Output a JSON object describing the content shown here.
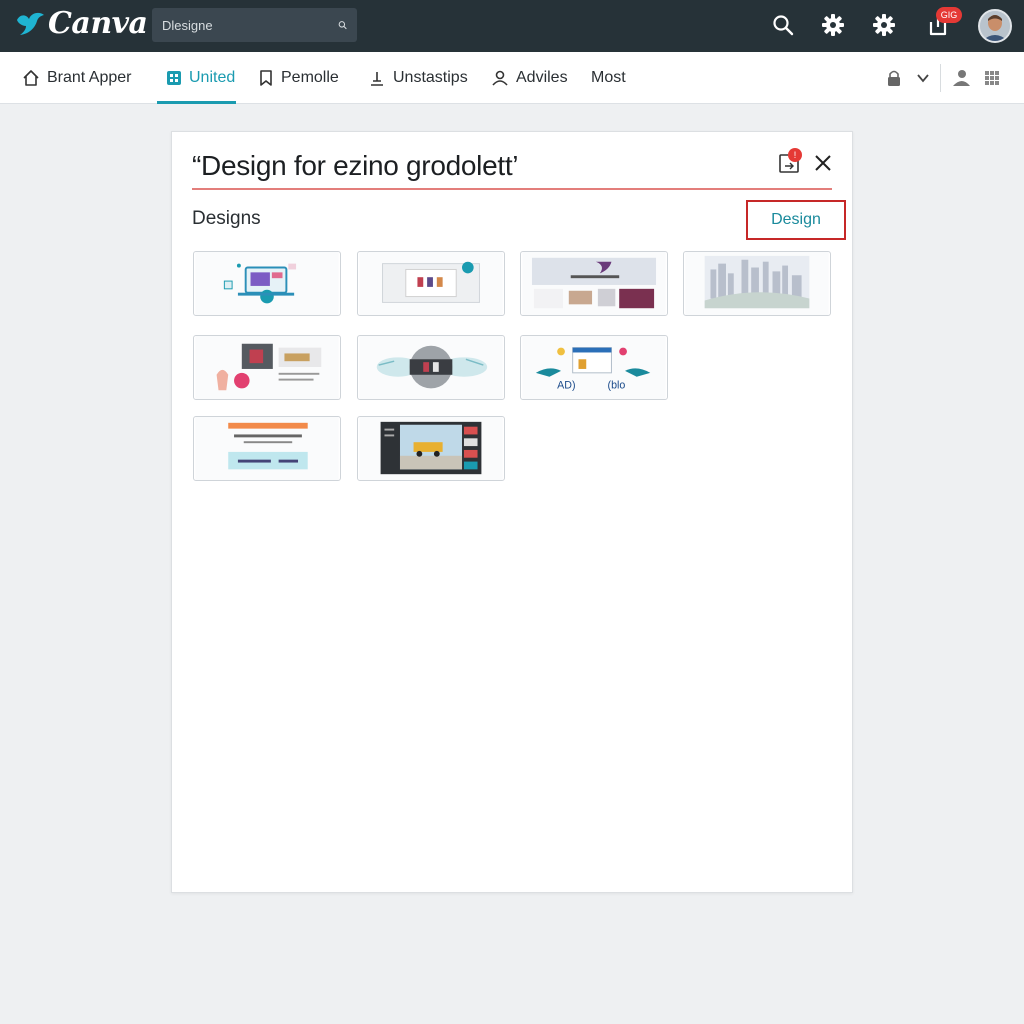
{
  "app": {
    "logo_text": "Canva",
    "brand_color": "#1fb4d2"
  },
  "search": {
    "placeholder": "Dlesigne"
  },
  "header": {
    "notification_badge": "GIG"
  },
  "nav": {
    "items": [
      {
        "label": "Brant Apper",
        "icon": "home-icon"
      },
      {
        "label": "United",
        "icon": "grid-icon",
        "active": true
      },
      {
        "label": "Pemolle",
        "icon": "bookmark-icon"
      },
      {
        "label": "Unstastips",
        "icon": "person-icon"
      },
      {
        "label": "Adviles",
        "icon": "users-icon"
      },
      {
        "label": "Most"
      }
    ]
  },
  "modal": {
    "title": "“Design for ezino grodolett’",
    "doc_badge": "!",
    "section_label": "Designs",
    "design_button": "Design",
    "thumb_texts": {
      "left_caption": "AD)",
      "right_caption": "(blo"
    }
  },
  "colors": {
    "topbar": "#263238",
    "accent": "#1a9bb0",
    "danger": "#c62828"
  }
}
